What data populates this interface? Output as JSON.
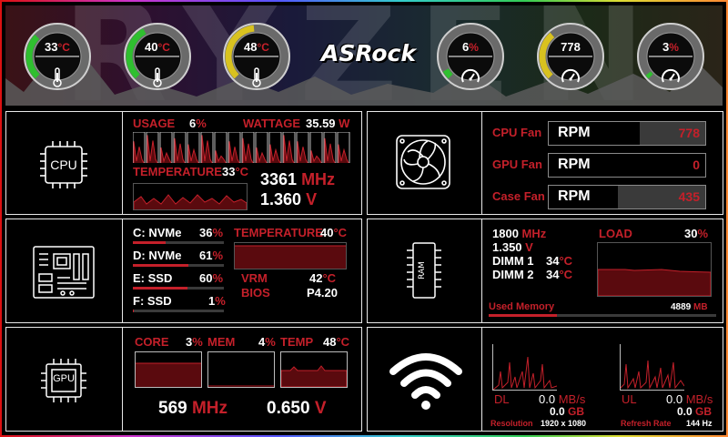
{
  "banner": {
    "logo_text": "ASRock",
    "background_word": "RYZEN",
    "gauges": [
      {
        "value": "33",
        "unit": "°C",
        "icon": "thermometer-icon",
        "level": 0.33,
        "color": "#2fbf2f"
      },
      {
        "value": "40",
        "unit": "°C",
        "icon": "thermometer-icon",
        "level": 0.4,
        "color": "#2fbf2f"
      },
      {
        "value": "48",
        "unit": "°C",
        "icon": "thermometer-icon",
        "level": 0.48,
        "color": "#d9c21f"
      },
      {
        "value": "6",
        "unit": "%",
        "icon": "speedometer-icon",
        "level": 0.06,
        "color": "#2fbf2f"
      },
      {
        "value": "778",
        "unit": "",
        "icon": "speedometer-icon",
        "level": 0.35,
        "color": "#d9c21f"
      },
      {
        "value": "3",
        "unit": "%",
        "icon": "speedometer-icon",
        "level": 0.03,
        "color": "#2fbf2f"
      }
    ]
  },
  "cpu": {
    "icon_label": "CPU",
    "usage_label": "USAGE",
    "usage_value": "6",
    "usage_unit": "%",
    "wattage_label": "WATTAGE",
    "wattage_value": "35.59",
    "wattage_unit": "W",
    "temperature_label": "TEMPERATURE",
    "temperature_value": "33",
    "temperature_unit": "°C",
    "clock_value": "3361",
    "clock_unit": "MHz",
    "voltage_value": "1.360",
    "voltage_unit": "V",
    "core_usage": [
      0.7,
      0.9,
      0.5,
      0.8,
      0.6,
      0.9,
      0.4,
      0.7,
      0.8,
      0.5,
      0.6,
      0.9,
      0.7,
      0.4,
      0.8,
      0.6
    ]
  },
  "fans": {
    "items": [
      {
        "label": "CPU Fan",
        "unit": "RPM",
        "value": "778",
        "level": 0.58
      },
      {
        "label": "GPU Fan",
        "unit": "RPM",
        "value": "0",
        "level": 1.0
      },
      {
        "label": "Case Fan",
        "unit": "RPM",
        "value": "435",
        "level": 0.44
      }
    ]
  },
  "storage": {
    "drives": [
      {
        "label": "C: NVMe",
        "value": "36",
        "unit": "%",
        "level": 0.36
      },
      {
        "label": "D: NVMe",
        "value": "61",
        "unit": "%",
        "level": 0.61
      },
      {
        "label": "E: SSD",
        "value": "60",
        "unit": "%",
        "level": 0.6
      },
      {
        "label": "F: SSD",
        "value": "1",
        "unit": "%",
        "level": 0.01
      }
    ],
    "temperature_label": "TEMPERATURE",
    "temperature_value": "40",
    "temperature_unit": "°C",
    "vrm_label": "VRM",
    "vrm_value": "42",
    "vrm_unit": "°C",
    "bios_label": "BIOS",
    "bios_value": "P4.20"
  },
  "memory": {
    "clock_value": "1800",
    "clock_unit": "MHz",
    "voltage_value": "1.350",
    "voltage_unit": "V",
    "dimm1_label": "DIMM 1",
    "dimm1_value": "34",
    "dimm1_unit": "°C",
    "dimm2_label": "DIMM 2",
    "dimm2_value": "34",
    "dimm2_unit": "°C",
    "load_label": "LOAD",
    "load_value": "30",
    "load_unit": "%",
    "used_label": "Used Memory",
    "used_value": "4889",
    "used_unit": "MB",
    "used_level": 0.3
  },
  "gpu": {
    "icon_label": "GPU",
    "core_label": "CORE",
    "core_value": "3",
    "core_unit": "%",
    "mem_label": "MEM",
    "mem_value": "4",
    "mem_unit": "%",
    "temp_label": "TEMP",
    "temp_value": "48",
    "temp_unit": "°C",
    "clock_value": "569",
    "clock_unit": "MHz",
    "voltage_value": "0.650",
    "voltage_unit": "V"
  },
  "network": {
    "dl_label": "DL",
    "dl_rate": "0.0",
    "dl_rate_unit": "MB/s",
    "dl_total": "0.0",
    "dl_total_unit": "GB",
    "ul_label": "UL",
    "ul_rate": "0.0",
    "ul_rate_unit": "MB/s",
    "ul_total": "0.0",
    "ul_total_unit": "GB",
    "resolution_label": "Resolution",
    "resolution_value": "1920 x 1080",
    "refresh_label": "Refresh Rate",
    "refresh_value": "144 Hz"
  },
  "colors": {
    "accent": "#c4202a",
    "border": "#e8e8e8",
    "green": "#2fbf2f",
    "yellow": "#d9c21f"
  }
}
